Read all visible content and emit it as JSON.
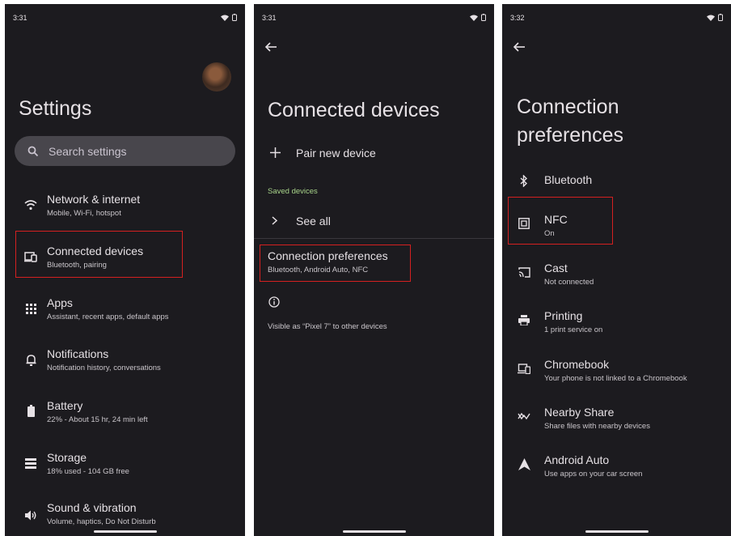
{
  "panel1": {
    "time": "3:31",
    "title": "Settings",
    "search_placeholder": "Search settings",
    "items": [
      {
        "title": "Network & internet",
        "subtitle": "Mobile, Wi-Fi, hotspot",
        "icon": "wifi-icon"
      },
      {
        "title": "Connected devices",
        "subtitle": "Bluetooth, pairing",
        "icon": "connected-devices-icon",
        "highlighted": true
      },
      {
        "title": "Apps",
        "subtitle": "Assistant, recent apps, default apps",
        "icon": "apps-grid-icon"
      },
      {
        "title": "Notifications",
        "subtitle": "Notification history, conversations",
        "icon": "bell-icon"
      },
      {
        "title": "Battery",
        "subtitle": "22% - About 15 hr, 24 min left",
        "icon": "battery-icon"
      },
      {
        "title": "Storage",
        "subtitle": "18% used - 104 GB free",
        "icon": "storage-icon"
      },
      {
        "title": "Sound & vibration",
        "subtitle": "Volume, haptics, Do Not Disturb",
        "icon": "volume-icon"
      }
    ]
  },
  "panel2": {
    "time": "3:31",
    "title": "Connected devices",
    "pair_label": "Pair new device",
    "saved_section": "Saved devices",
    "see_all": "See all",
    "pref_title": "Connection preferences",
    "pref_subtitle": "Bluetooth, Android Auto, NFC",
    "footer_text": "Visible as “Pixel 7” to other devices"
  },
  "panel3": {
    "time": "3:32",
    "title_line1": "Connection",
    "title_line2": "preferences",
    "items": [
      {
        "title": "Bluetooth",
        "subtitle": "",
        "icon": "bluetooth-icon"
      },
      {
        "title": "NFC",
        "subtitle": "On",
        "icon": "nfc-icon",
        "highlighted": true
      },
      {
        "title": "Cast",
        "subtitle": "Not connected",
        "icon": "cast-icon"
      },
      {
        "title": "Printing",
        "subtitle": "1 print service on",
        "icon": "printer-icon"
      },
      {
        "title": "Chromebook",
        "subtitle": "Your phone is not linked to a Chromebook",
        "icon": "chromebook-icon"
      },
      {
        "title": "Nearby Share",
        "subtitle": "Share files with nearby devices",
        "icon": "nearby-share-icon"
      },
      {
        "title": "Android Auto",
        "subtitle": "Use apps on your car screen",
        "icon": "android-auto-icon"
      }
    ]
  },
  "colors": {
    "background": "#1c1b1f",
    "text": "#e6e1e5",
    "accent_section": "#a8d48a",
    "highlight_box": "#d42020"
  }
}
